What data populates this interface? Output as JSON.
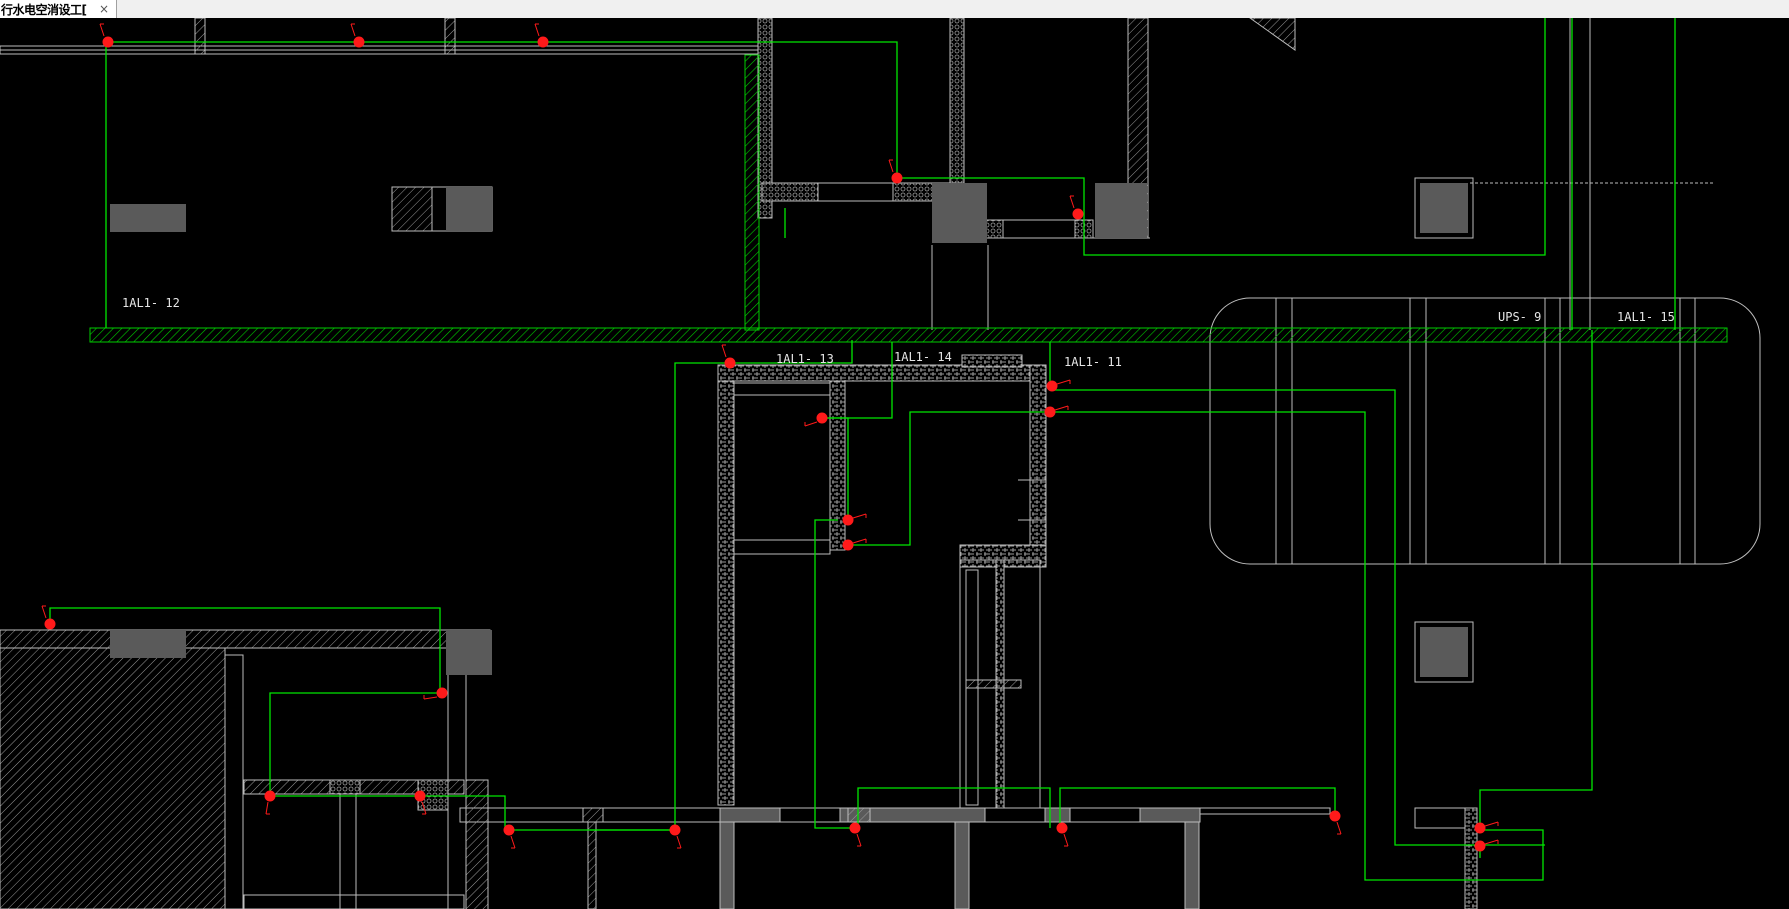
{
  "tab": {
    "title": "行水电空消设工[",
    "close_glyph": "×"
  },
  "cad": {
    "circuit_labels": {
      "c12": "1AL1-   12",
      "c13": "1AL1-   13",
      "c14": "1AL1-   14",
      "c11": "1AL1-   11",
      "ups9": "UPS-  9",
      "c15": "1AL1-   15"
    },
    "colors": {
      "background": "#000000",
      "wire": "#00ff00",
      "fixture": "#ff0000",
      "wall_hatch": "#00cc00",
      "structure": "#5a5a5a",
      "outline": "#bdbdbd"
    }
  }
}
